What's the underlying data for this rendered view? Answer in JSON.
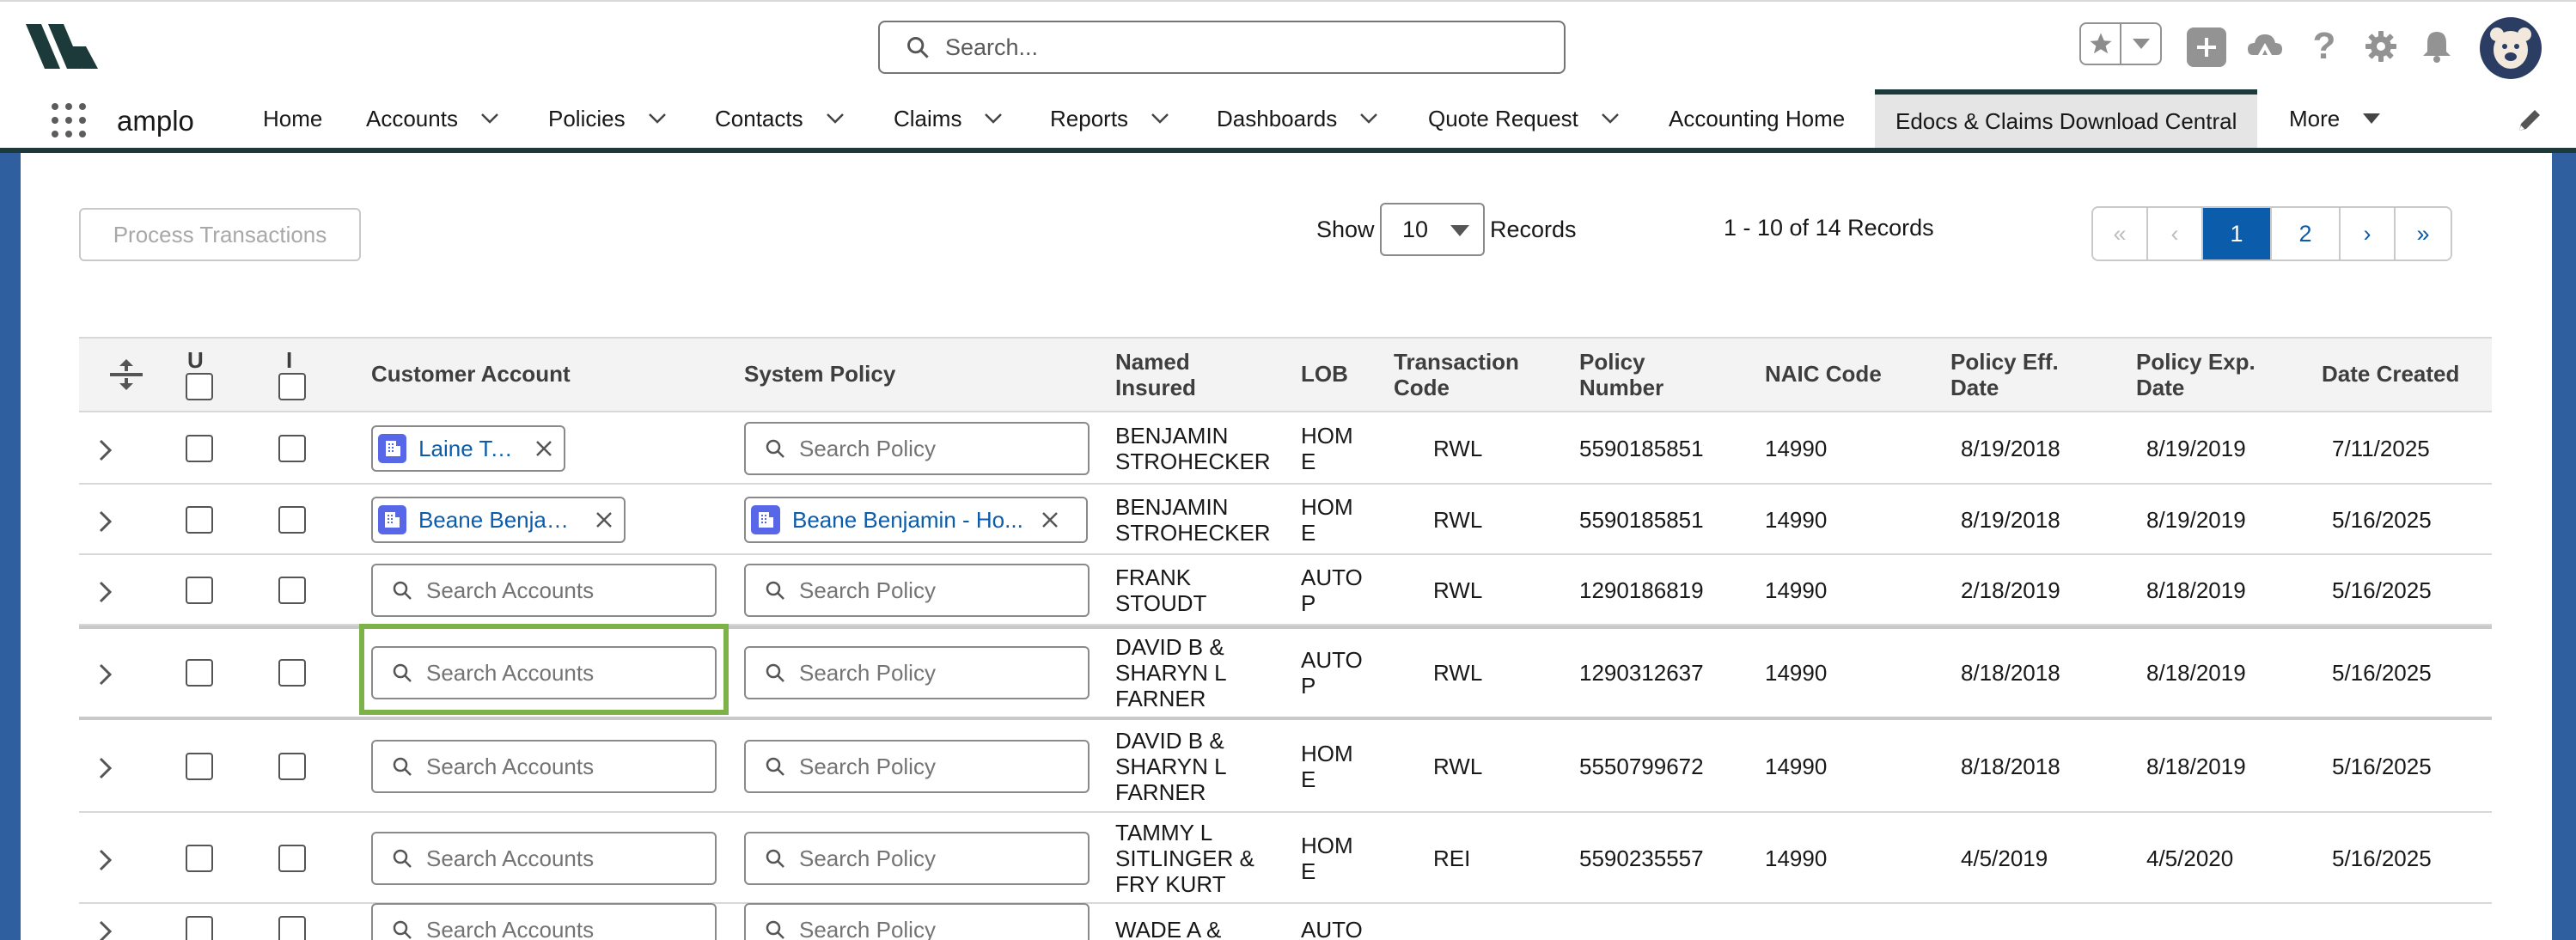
{
  "header": {
    "search_placeholder": "Search...",
    "icons": [
      "brand-logo-icon",
      "search-icon",
      "star-icon",
      "chevron-down-icon",
      "plus-icon",
      "trailhead-icon",
      "help-icon",
      "gear-icon",
      "bell-icon",
      "avatar"
    ]
  },
  "nav": {
    "app_name": "amplo",
    "items": [
      {
        "label": "Home",
        "has_menu": false
      },
      {
        "label": "Accounts",
        "has_menu": true
      },
      {
        "label": "Policies",
        "has_menu": true
      },
      {
        "label": "Contacts",
        "has_menu": true
      },
      {
        "label": "Claims",
        "has_menu": true
      },
      {
        "label": "Reports",
        "has_menu": true
      },
      {
        "label": "Dashboards",
        "has_menu": true
      },
      {
        "label": "Quote Request",
        "has_menu": true
      },
      {
        "label": "Accounting Home",
        "has_menu": false
      },
      {
        "label": "Edocs & Claims Download Central",
        "has_menu": false,
        "active": true
      },
      {
        "label": "More",
        "has_menu": true
      }
    ]
  },
  "toolbar": {
    "process_button": "Process Transactions",
    "show_label": "Show",
    "page_size": "10",
    "records_label": "Records",
    "range_text": "1 - 10 of 14 Records"
  },
  "pagination": {
    "first": "«",
    "prev": "‹",
    "pages": [
      "1",
      "2"
    ],
    "current": "1",
    "next": "›",
    "last": "»"
  },
  "table": {
    "headers": {
      "u": "U",
      "i": "I",
      "customer_account": "Customer Account",
      "system_policy": "System Policy",
      "named_insured": [
        "Named",
        "Insured"
      ],
      "lob": "LOB",
      "transaction_code": [
        "Transaction",
        "Code"
      ],
      "policy_number": [
        "Policy",
        "Number"
      ],
      "naic_code": "NAIC Code",
      "policy_eff_date": [
        "Policy Eff.",
        "Date"
      ],
      "policy_exp_date": [
        "Policy Exp.",
        "Date"
      ],
      "date_created": "Date Created"
    },
    "lookup_placeholders": {
      "account": "Search Accounts",
      "policy": "Search Policy"
    },
    "rows": [
      {
        "account": "Laine Test",
        "policy": "",
        "insured": [
          "BENJAMIN",
          "STROHECKER"
        ],
        "lob": [
          "HOM",
          "E"
        ],
        "txn": "RWL",
        "policy_number": "5590185851",
        "naic": "14990",
        "eff": "8/19/2018",
        "exp": "8/19/2019",
        "created": "7/11/2025"
      },
      {
        "account": "Beane Benjamin",
        "policy": "Beane Benjamin - Ho...",
        "insured": [
          "BENJAMIN",
          "STROHECKER"
        ],
        "lob": [
          "HOM",
          "E"
        ],
        "txn": "RWL",
        "policy_number": "5590185851",
        "naic": "14990",
        "eff": "8/19/2018",
        "exp": "8/19/2019",
        "created": "5/16/2025"
      },
      {
        "account": "",
        "policy": "",
        "insured": [
          "FRANK",
          "STOUDT"
        ],
        "lob": [
          "AUTO",
          "P"
        ],
        "txn": "RWL",
        "policy_number": "1290186819",
        "naic": "14990",
        "eff": "2/18/2019",
        "exp": "8/18/2019",
        "created": "5/16/2025"
      },
      {
        "account": "",
        "policy": "",
        "insured": [
          "DAVID B &",
          "SHARYN L",
          "FARNER"
        ],
        "lob": [
          "AUTO",
          "P"
        ],
        "txn": "RWL",
        "policy_number": "1290312637",
        "naic": "14990",
        "eff": "8/18/2018",
        "exp": "8/18/2019",
        "created": "5/16/2025"
      },
      {
        "account": "",
        "policy": "",
        "insured": [
          "DAVID B &",
          "SHARYN L",
          "FARNER"
        ],
        "lob": [
          "HOM",
          "E"
        ],
        "txn": "RWL",
        "policy_number": "5550799672",
        "naic": "14990",
        "eff": "8/18/2018",
        "exp": "8/18/2019",
        "created": "5/16/2025"
      },
      {
        "account": "",
        "policy": "",
        "insured": [
          "TAMMY L",
          "SITLINGER &",
          "FRY KURT"
        ],
        "lob": [
          "HOM",
          "E"
        ],
        "txn": "REI",
        "policy_number": "5590235557",
        "naic": "14990",
        "eff": "4/5/2019",
        "exp": "4/5/2020",
        "created": "5/16/2025"
      },
      {
        "account": "",
        "policy": "",
        "insured": [
          "WADE A &"
        ],
        "lob": [
          "AUTO"
        ],
        "txn": "",
        "policy_number": "",
        "naic": "",
        "eff": "",
        "exp": "",
        "created": ""
      }
    ]
  }
}
